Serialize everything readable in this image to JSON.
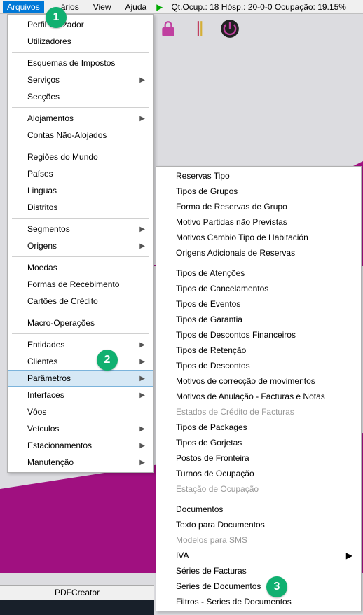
{
  "menubar": {
    "items": [
      "Arquivos",
      "...ários",
      "View",
      "Ajuda"
    ],
    "status": "Qt.Ocup.: 18 Hósp.: 20-0-0 Ocupação: 19.15%"
  },
  "badges": {
    "b1": "1",
    "b2": "2",
    "b3": "3"
  },
  "dropdown": [
    {
      "label": "Perfil Utilizador"
    },
    {
      "label": "Utilizadores"
    },
    {
      "sep": true
    },
    {
      "label": "Esquemas de Impostos"
    },
    {
      "label": "Serviços",
      "sub": true
    },
    {
      "label": "Secções"
    },
    {
      "sep": true
    },
    {
      "label": "Alojamentos",
      "sub": true
    },
    {
      "label": "Contas Não-Alojados"
    },
    {
      "sep": true
    },
    {
      "label": "Regiões do Mundo"
    },
    {
      "label": "Países"
    },
    {
      "label": "Linguas"
    },
    {
      "label": "Distritos"
    },
    {
      "sep": true
    },
    {
      "label": "Segmentos",
      "sub": true
    },
    {
      "label": "Origens",
      "sub": true
    },
    {
      "sep": true
    },
    {
      "label": "Moedas"
    },
    {
      "label": "Formas de Recebimento"
    },
    {
      "label": "Cartões de Crédito"
    },
    {
      "sep": true
    },
    {
      "label": "Macro-Operações"
    },
    {
      "sep": true
    },
    {
      "label": "Entidades",
      "sub": true
    },
    {
      "label": "Clientes",
      "sub": true
    },
    {
      "label": "Parâmetros",
      "sub": true,
      "highlight": true
    },
    {
      "label": "Interfaces",
      "sub": true
    },
    {
      "label": "Vôos"
    },
    {
      "label": "Veículos",
      "sub": true
    },
    {
      "label": "Estacionamentos",
      "sub": true
    },
    {
      "label": "Manutenção",
      "sub": true
    }
  ],
  "submenu": [
    {
      "label": "Reservas Tipo"
    },
    {
      "label": "Tipos de Grupos"
    },
    {
      "label": "Forma de Reservas de Grupo"
    },
    {
      "label": "Motivo Partidas não Previstas"
    },
    {
      "label": "Motivos Cambio Tipo de Habitación"
    },
    {
      "label": "Origens Adicionais de Reservas"
    },
    {
      "sep": true
    },
    {
      "label": "Tipos de Atenções"
    },
    {
      "label": "Tipos de Cancelamentos"
    },
    {
      "label": "Tipos de Eventos"
    },
    {
      "label": "Tipos de Garantia"
    },
    {
      "label": "Tipos de Descontos Financeiros"
    },
    {
      "label": "Tipos de Retenção"
    },
    {
      "label": "Tipos de Descontos"
    },
    {
      "label": "Motivos de correcção de movimentos"
    },
    {
      "label": "Motivos de Anulação - Facturas e Notas"
    },
    {
      "label": "Estados de Crédito de Facturas",
      "disabled": true
    },
    {
      "label": "Tipos de Packages"
    },
    {
      "label": "Tipos de Gorjetas"
    },
    {
      "label": "Postos de Fronteira"
    },
    {
      "label": "Turnos de Ocupação"
    },
    {
      "label": "Estação de Ocupação",
      "disabled": true
    },
    {
      "sep": true
    },
    {
      "label": "Documentos"
    },
    {
      "label": "Texto para Documentos"
    },
    {
      "label": "Modelos para SMS",
      "disabled": true
    },
    {
      "label": "IVA",
      "sub": true
    },
    {
      "label": "Séries de Facturas"
    },
    {
      "label": "Series de Documentos"
    },
    {
      "label": "Filtros - Series de Documentos"
    }
  ],
  "pdfcreator": "PDFCreator"
}
